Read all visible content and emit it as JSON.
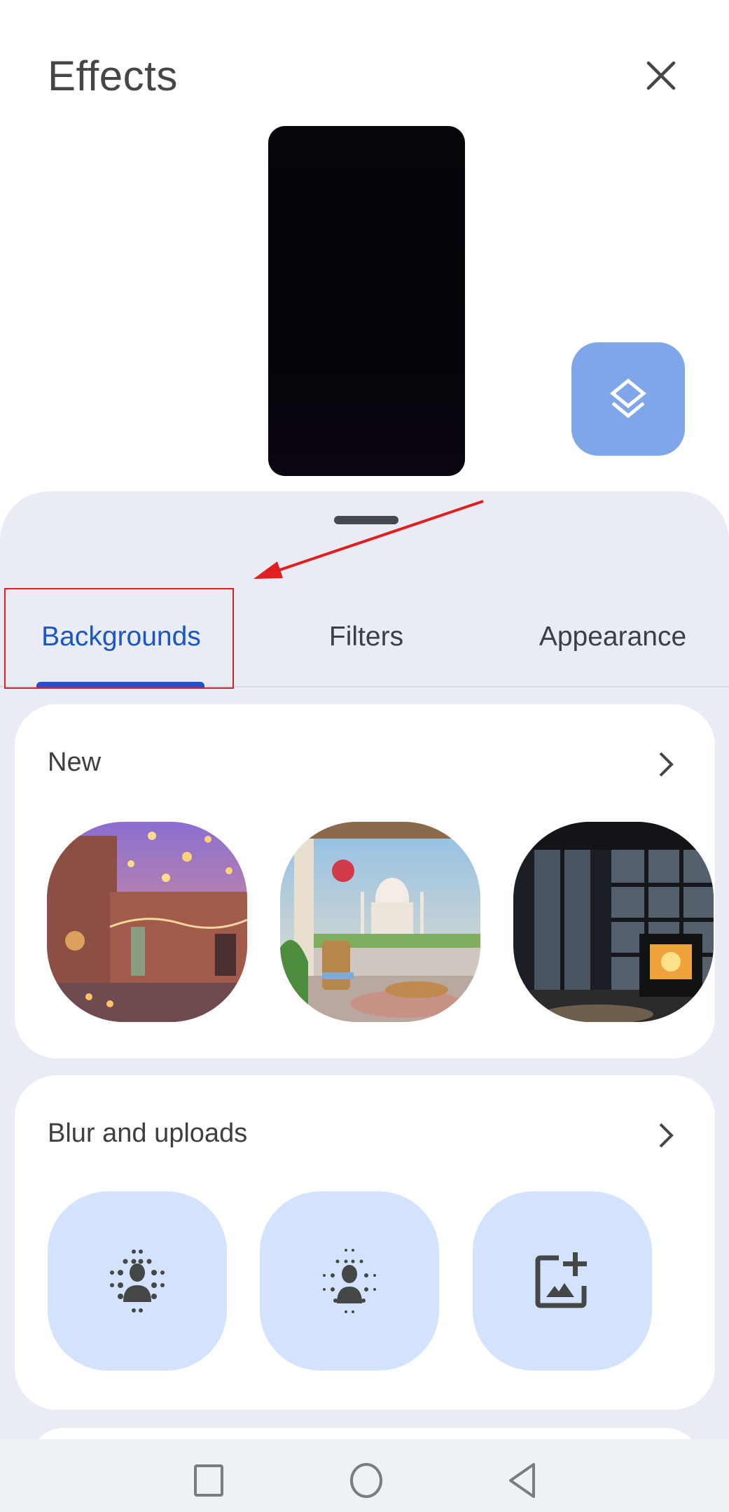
{
  "header": {
    "title": "Effects",
    "close_icon": "close-icon"
  },
  "preview": {
    "layers_icon": "layers-icon"
  },
  "tabs": [
    {
      "label": "Backgrounds",
      "active": true
    },
    {
      "label": "Filters",
      "active": false
    },
    {
      "label": "Appearance",
      "active": false
    }
  ],
  "sections": {
    "new": {
      "title": "New",
      "chevron_icon": "chevron-right-icon",
      "items": [
        {
          "name": "Lantern-lit street at dusk"
        },
        {
          "name": "Terrace view of Taj Mahal"
        },
        {
          "name": "Dark room with fireplace"
        }
      ]
    },
    "blur_and_uploads": {
      "title": "Blur and uploads",
      "chevron_icon": "chevron-right-icon",
      "items": [
        {
          "name": "Blur background",
          "icon": "blur-on-icon"
        },
        {
          "name": "Slightly blur background",
          "icon": "blur-light-icon"
        },
        {
          "name": "Upload background",
          "icon": "add-photo-icon"
        }
      ]
    }
  },
  "annotation": {
    "color": "#e02020",
    "target": "Backgrounds"
  },
  "colors": {
    "accent": "#1a56c4",
    "sheet_bg": "#e9ebf5",
    "tile_bg": "#d3e3fd",
    "layers_btn": "#7ea6e8"
  },
  "navbar": {
    "recents_icon": "square-icon",
    "home_icon": "circle-icon",
    "back_icon": "triangle-back-icon"
  }
}
